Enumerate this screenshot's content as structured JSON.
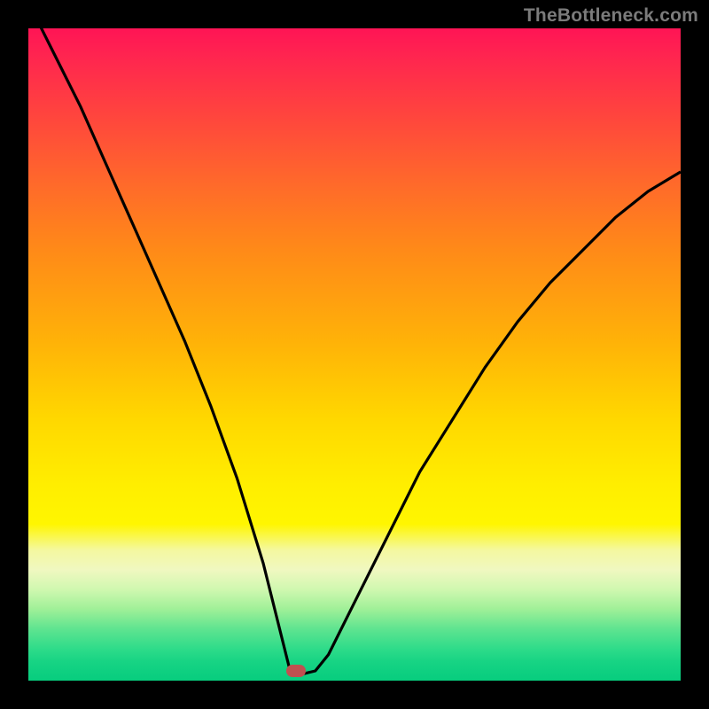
{
  "watermark_text": "TheBottleneck.com",
  "colors": {
    "frame_background": "#000000",
    "curve_stroke": "#000000",
    "marker_fill": "#c05050",
    "watermark": "#7b7b7b",
    "gradient_stops": [
      {
        "pos": 0.0,
        "color": "#ff1455"
      },
      {
        "pos": 0.12,
        "color": "#ff4040"
      },
      {
        "pos": 0.34,
        "color": "#ff8a18"
      },
      {
        "pos": 0.6,
        "color": "#ffd800"
      },
      {
        "pos": 0.8,
        "color": "#f4f8a0"
      },
      {
        "pos": 0.92,
        "color": "#60e490"
      },
      {
        "pos": 1.0,
        "color": "#08cd7e"
      }
    ]
  },
  "chart_data": {
    "type": "line",
    "title": "",
    "xlabel": "",
    "ylabel": "",
    "xlim": [
      0,
      100
    ],
    "ylim": [
      0,
      100
    ],
    "note": "Bottleneck curve. x is relative position across plot (0-100), y is bottleneck percentage (0=ideal at bottom, 100=severe at top). Red marker indicates optimal point near x≈41.",
    "marker": {
      "x": 41,
      "y": 1.5
    },
    "series": [
      {
        "name": "bottleneck-curve",
        "x": [
          0,
          4,
          8,
          12,
          16,
          20,
          24,
          28,
          32,
          36,
          38,
          40,
          42,
          44,
          46,
          50,
          55,
          60,
          65,
          70,
          75,
          80,
          85,
          90,
          95,
          100
        ],
        "y": [
          104,
          96,
          88,
          79,
          70,
          61,
          52,
          42,
          31,
          18,
          10,
          2,
          1,
          1.5,
          4,
          12,
          22,
          32,
          40,
          48,
          55,
          61,
          66,
          71,
          75,
          78
        ]
      }
    ]
  }
}
